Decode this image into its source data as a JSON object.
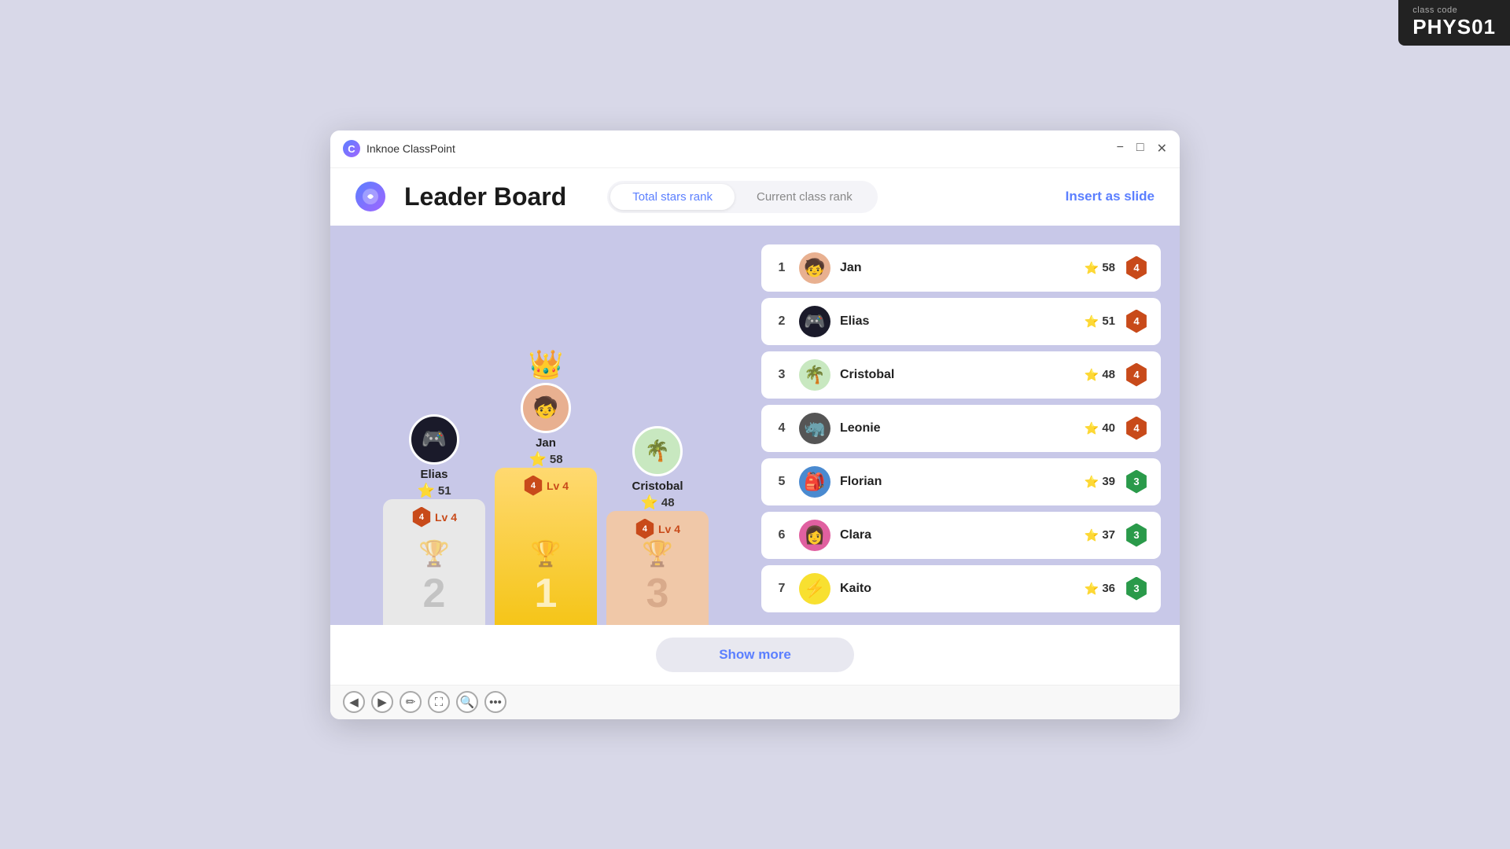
{
  "classCode": {
    "label": "class\ncode",
    "labelLine1": "class",
    "labelLine2": "code",
    "id": "PHYS01"
  },
  "window": {
    "appName": "Inknoe ClassPoint",
    "controls": [
      "−",
      "□",
      "✕"
    ]
  },
  "header": {
    "title": "Leader Board",
    "tabs": [
      {
        "label": "Total stars rank",
        "active": true
      },
      {
        "label": "Current class rank",
        "active": false
      }
    ],
    "insertBtn": "Insert as slide"
  },
  "podium": {
    "players": [
      {
        "rank": 2,
        "name": "Elias",
        "stars": 51,
        "level": 4,
        "levelBadgeColor": "orange",
        "podiumType": "second"
      },
      {
        "rank": 1,
        "name": "Jan",
        "stars": 58,
        "level": 4,
        "levelBadgeColor": "orange",
        "podiumType": "first",
        "hasCrown": true
      },
      {
        "rank": 3,
        "name": "Cristobal",
        "stars": 48,
        "level": 4,
        "levelBadgeColor": "orange",
        "podiumType": "third"
      }
    ]
  },
  "rankings": [
    {
      "rank": 1,
      "name": "Jan",
      "stars": 58,
      "level": 4,
      "badgeColor": "orange",
      "avatarBg": "#e8b090",
      "avatarEmoji": "🧒"
    },
    {
      "rank": 2,
      "name": "Elias",
      "stars": 51,
      "level": 4,
      "badgeColor": "orange",
      "avatarBg": "#1a1a2a",
      "avatarEmoji": "🎮"
    },
    {
      "rank": 3,
      "name": "Cristobal",
      "stars": 48,
      "level": 4,
      "badgeColor": "orange",
      "avatarBg": "#c8e8c0",
      "avatarEmoji": "🌴"
    },
    {
      "rank": 4,
      "name": "Leonie",
      "stars": 40,
      "level": 4,
      "badgeColor": "orange",
      "avatarBg": "#555",
      "avatarEmoji": "🦏"
    },
    {
      "rank": 5,
      "name": "Florian",
      "stars": 39,
      "level": 3,
      "badgeColor": "green",
      "avatarBg": "#4a8ad0",
      "avatarEmoji": "🎒"
    },
    {
      "rank": 6,
      "name": "Clara",
      "stars": 37,
      "level": 3,
      "badgeColor": "green",
      "avatarBg": "#e060a0",
      "avatarEmoji": "👩"
    },
    {
      "rank": 7,
      "name": "Kaito",
      "stars": 36,
      "level": 3,
      "badgeColor": "green",
      "avatarBg": "#f8e030",
      "avatarEmoji": "⚡"
    }
  ],
  "showMoreBtn": "Show more",
  "toolbar": {
    "buttons": [
      "◀",
      "▶",
      "✏",
      "⛶",
      "🔍",
      "•••"
    ]
  }
}
